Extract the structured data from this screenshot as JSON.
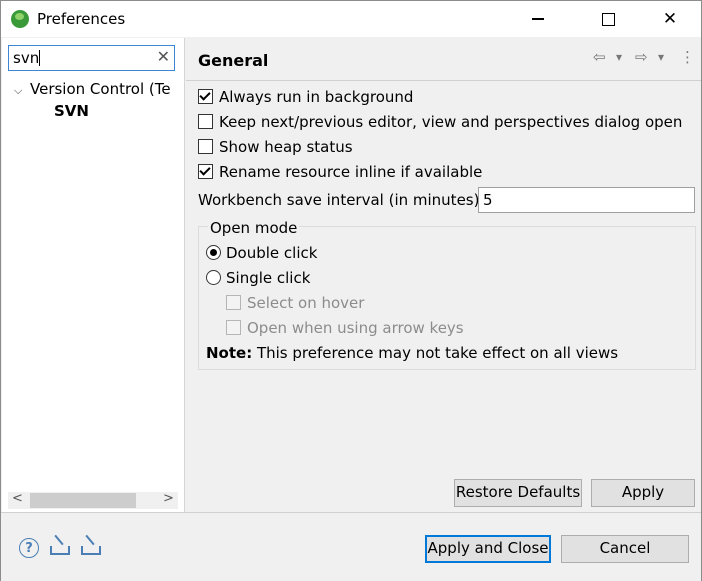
{
  "window": {
    "title": "Preferences",
    "minimize": "—",
    "close": "✕"
  },
  "sidebar": {
    "filter_value": "svn",
    "clear_icon": "✕",
    "tree": [
      {
        "label": "Version Control (Te",
        "expanded": true
      },
      {
        "label": "SVN"
      }
    ],
    "scroll_left": "<",
    "scroll_right": ">"
  },
  "page": {
    "title": "General",
    "nav": {
      "back": "⇦",
      "back_drop": "▾",
      "forward": "⇨",
      "forward_drop": "▾",
      "menu": "⋮"
    },
    "options": {
      "always_background": {
        "label": "Always run in background",
        "checked": true
      },
      "keep_next_prev": {
        "label": "Keep next/previous editor, view and perspectives dialog open",
        "checked": false
      },
      "show_heap": {
        "label": "Show heap status",
        "checked": false
      },
      "rename_inline": {
        "label": "Rename resource inline if available",
        "checked": true
      }
    },
    "save_interval": {
      "label": "Workbench save interval (in minutes):",
      "value": "5"
    },
    "open_mode": {
      "title": "Open mode",
      "double_click": "Double click",
      "single_click": "Single click",
      "select_on_hover": "Select on hover",
      "open_arrow_keys": "Open when using arrow keys",
      "selected": "Double click"
    },
    "note": {
      "bold": "Note:",
      "text": " This preference may not take effect on all views"
    },
    "restore_defaults": "Restore Defaults",
    "apply": "Apply"
  },
  "footer": {
    "help_icon": "?",
    "apply_and_close": "Apply and Close",
    "cancel": "Cancel"
  },
  "colors": {
    "focus": "#0078d7",
    "icon_blue": "#4a7eb5"
  }
}
